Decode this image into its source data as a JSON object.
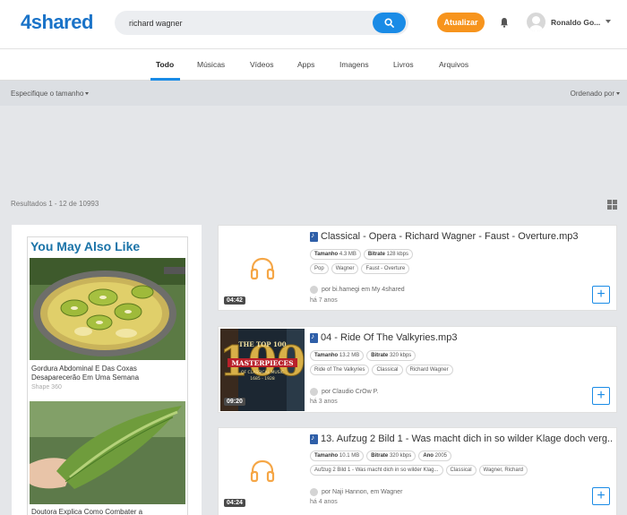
{
  "header": {
    "logo_num": "4",
    "logo_word": "shared",
    "search_value": "richard wagner",
    "update_label": "Atualizar",
    "username": "Ronaldo Go..."
  },
  "tabs": [
    {
      "label": "Todo",
      "active": true
    },
    {
      "label": "Músicas"
    },
    {
      "label": "Vídeos"
    },
    {
      "label": "Apps"
    },
    {
      "label": "Imagens"
    },
    {
      "label": "Livros"
    },
    {
      "label": "Arquivos"
    }
  ],
  "filters": {
    "size_label": "Especifique o tamanho",
    "sort_label": "Ordenado por"
  },
  "results_text": "Resultados 1 - 12 de 10993",
  "ad": {
    "title": "You May Also Like",
    "item1_caption": "Gordura Abdominal E Das Coxas Desaparecerão Em Uma Semana",
    "item1_source": "Shape 360",
    "item2_caption": "Doutora Explica Como Combater a"
  },
  "files": [
    {
      "title": "Classical - Opera - Richard Wagner - Faust - Overture.mp3",
      "duration": "04:42",
      "size_label": "Tamanho",
      "size": "4.3 MB",
      "bitrate_label": "Bitrate",
      "bitrate": "128 kbps",
      "tags": [
        "Pop",
        "Wagner",
        "Faust - Overture"
      ],
      "by": "por bi.hamegi em My 4shared",
      "age": "há 7 anos"
    },
    {
      "title": "04 - Ride Of The Valkyries.mp3",
      "duration": "09:20",
      "size_label": "Tamanho",
      "size": "13.2 MB",
      "bitrate_label": "Bitrate",
      "bitrate": "320 kbps",
      "tags": [
        "Ride of The Valkyries",
        "Classical",
        "Richard Wagner"
      ],
      "by": "por Claudio CrOw P.",
      "age": "há 3 anos",
      "cover_top": "THE TOP 100",
      "cover_mid": "MASTERPIECES",
      "cover_sub": "OF CLASSICAL MUSIC",
      "cover_years": "1685 - 1928",
      "cover_big": "100"
    },
    {
      "title": "13. Aufzug 2 Bild 1 - Was macht dich in so wilder Klage doch verg...",
      "duration": "04:24",
      "size_label": "Tamanho",
      "size": "10.1 MB",
      "bitrate_label": "Bitrate",
      "bitrate": "320 kbps",
      "year_label": "Ano",
      "year": "2005",
      "tags": [
        "Aufzug 2 Bild 1 - Was macht dich in so wilder Klag...",
        "Classical",
        "Wagner, Richard"
      ],
      "by": "por Naji Hannon",
      "by_suffix": ", em Wagner",
      "age": "há 4 anos"
    }
  ],
  "colors": {
    "brand_blue": "#1a73c8",
    "accent_blue": "#1a8be6",
    "update_orange": "#f7941d",
    "headphone_orange": "#f5a646"
  }
}
